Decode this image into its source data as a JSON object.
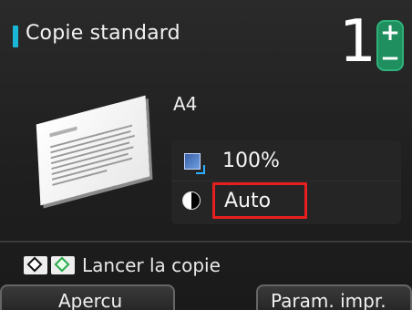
{
  "header": {
    "title": "Copie standard",
    "copies": "1",
    "plus_symbol": "+",
    "minus_symbol": "−"
  },
  "document": {
    "paper_size": "A4"
  },
  "settings": {
    "zoom_value": "100%",
    "density_value": "Auto"
  },
  "start": {
    "label": "Lancer la copie"
  },
  "tabs": {
    "preview": "Apercu",
    "print_settings": "Param. impr."
  },
  "icons": {
    "title_accent": "title-accent-bar",
    "zoom": "zoom-icon",
    "contrast": "contrast-icon",
    "start_bw": "black-start-icon",
    "start_color": "color-start-icon"
  },
  "colors": {
    "accent": "#19b6d6",
    "highlight": "#e62020",
    "stepper": "#1f8f5f"
  }
}
